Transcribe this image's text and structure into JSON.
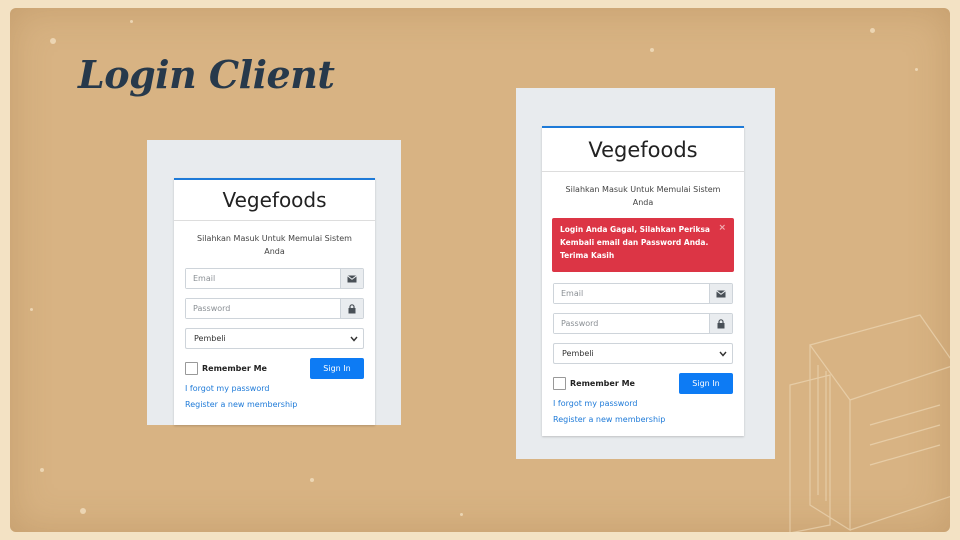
{
  "slide": {
    "title": "Login Client",
    "colors": {
      "background": "#d8b383",
      "title": "#27394b",
      "accent": "#1e7ad8",
      "alert": "#dc3545",
      "button": "#0d7bf4"
    }
  },
  "login_normal": {
    "brand": "Vegefoods",
    "message": "Silahkan Masuk Untuk Memulai Sistem Anda",
    "email_placeholder": "Email",
    "password_placeholder": "Password",
    "role_selected": "Pembeli",
    "remember_label": "Remember Me",
    "signin_label": "Sign In",
    "forgot_link": "I forgot my password",
    "register_link": "Register a new membership",
    "icons": [
      "envelope-icon",
      "lock-icon",
      "chevron-down-icon"
    ]
  },
  "login_error": {
    "brand": "Vegefoods",
    "message": "Silahkan Masuk Untuk Memulai Sistem Anda",
    "alert_text": "Login Anda Gagal, Silahkan Periksa Kembali email dan Password Anda. Terima Kasih",
    "alert_close": "×",
    "email_placeholder": "Email",
    "password_placeholder": "Password",
    "role_selected": "Pembeli",
    "remember_label": "Remember Me",
    "signin_label": "Sign In",
    "forgot_link": "I forgot my password",
    "register_link": "Register a new membership",
    "icons": [
      "envelope-icon",
      "lock-icon",
      "chevron-down-icon",
      "close-icon"
    ]
  }
}
